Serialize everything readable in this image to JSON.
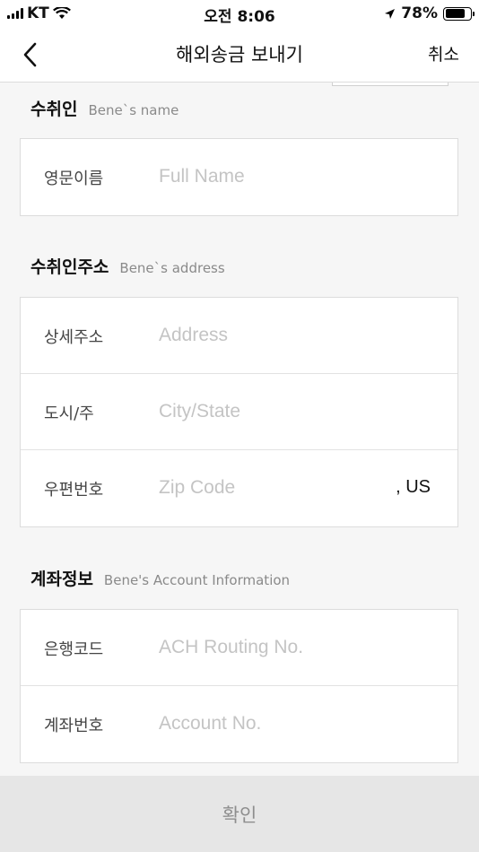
{
  "status_bar": {
    "carrier": "KT",
    "time": "오전 8:06",
    "battery": "78%",
    "battery_level": 0.78
  },
  "nav": {
    "title": "해외송금 보내기",
    "cancel_label": "취소"
  },
  "sections": {
    "beneficiary": {
      "title": "수취인",
      "subtitle": "Bene`s name",
      "rows": [
        {
          "label": "영문이름",
          "placeholder": "Full Name"
        }
      ]
    },
    "address": {
      "title": "수취인주소",
      "subtitle": "Bene`s address",
      "rows": [
        {
          "label": "상세주소",
          "placeholder": "Address"
        },
        {
          "label": "도시/주",
          "placeholder": "City/State"
        },
        {
          "label": "우편번호",
          "placeholder": "Zip Code",
          "suffix": ", US"
        }
      ]
    },
    "account": {
      "title": "계좌정보",
      "subtitle": "Bene's Account Information",
      "rows": [
        {
          "label": "은행코드",
          "placeholder": "ACH Routing No."
        },
        {
          "label": "계좌번호",
          "placeholder": "Account No."
        }
      ]
    }
  },
  "confirm_label": "확인"
}
